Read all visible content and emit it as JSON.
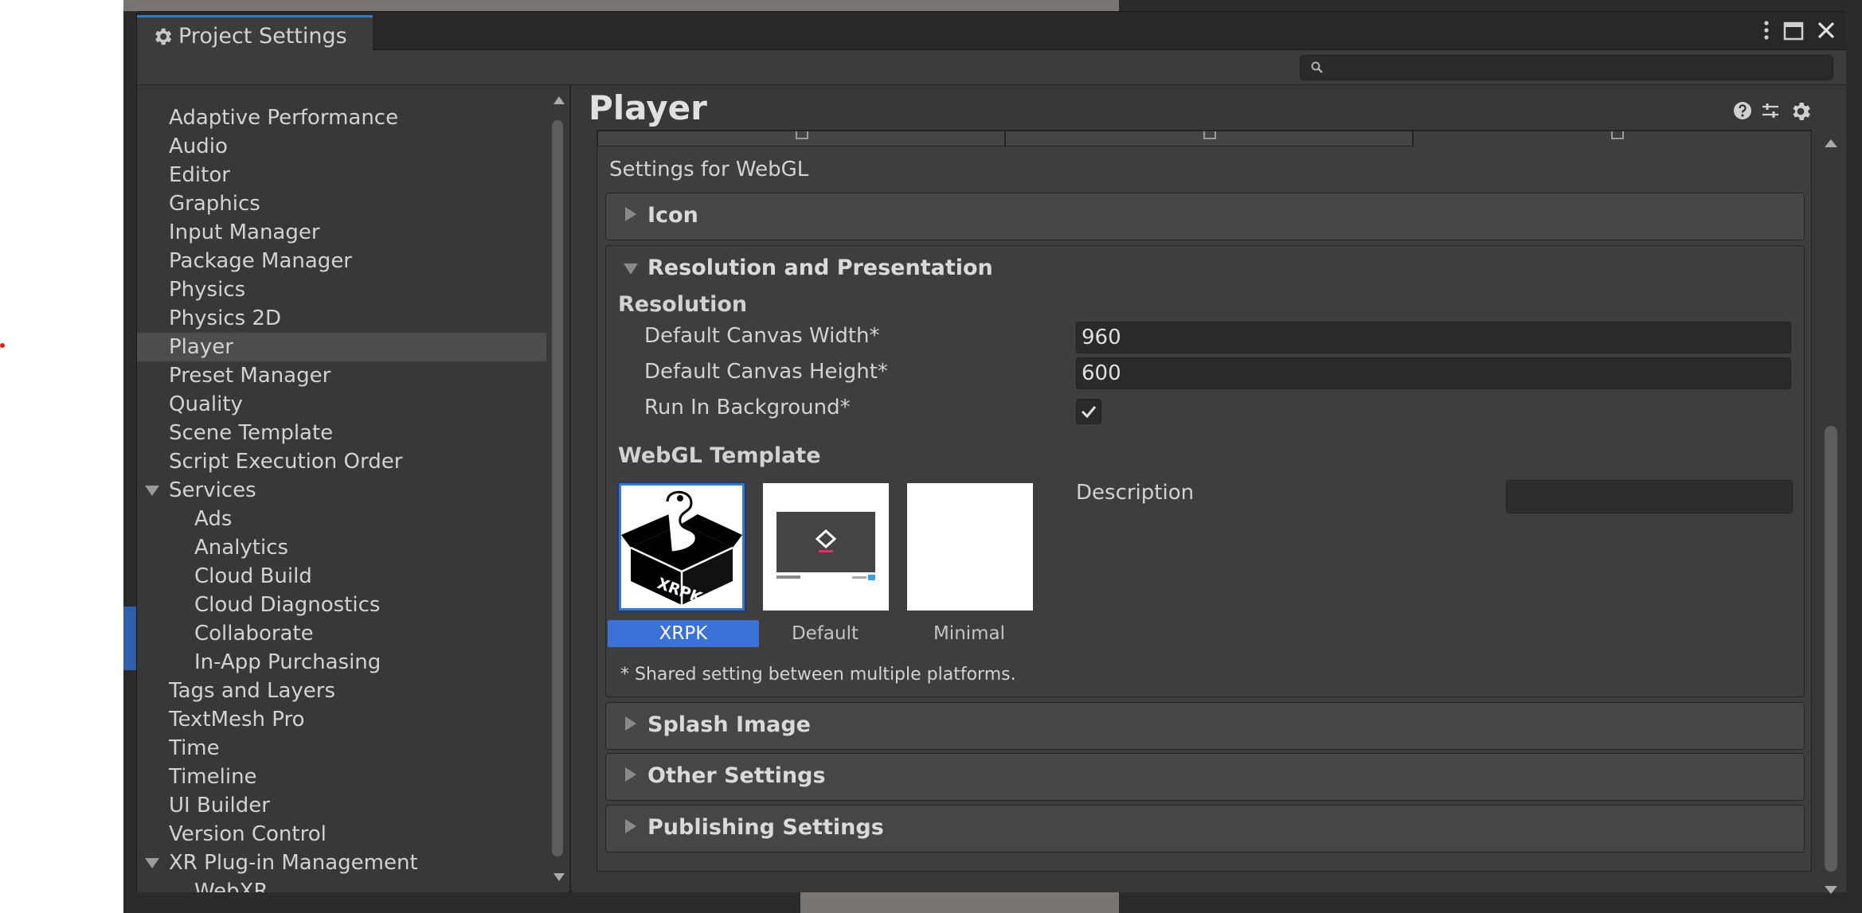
{
  "window": {
    "tab_title": "Project Settings",
    "search_placeholder": ""
  },
  "sidebar": {
    "items": [
      {
        "label": "Adaptive Performance"
      },
      {
        "label": "Audio"
      },
      {
        "label": "Editor"
      },
      {
        "label": "Graphics"
      },
      {
        "label": "Input Manager"
      },
      {
        "label": "Package Manager"
      },
      {
        "label": "Physics"
      },
      {
        "label": "Physics 2D"
      },
      {
        "label": "Player",
        "selected": true
      },
      {
        "label": "Preset Manager"
      },
      {
        "label": "Quality"
      },
      {
        "label": "Scene Template"
      },
      {
        "label": "Script Execution Order"
      },
      {
        "label": "Services",
        "expanded": true
      },
      {
        "label": "Ads"
      },
      {
        "label": "Analytics"
      },
      {
        "label": "Cloud Build"
      },
      {
        "label": "Cloud Diagnostics"
      },
      {
        "label": "Collaborate"
      },
      {
        "label": "In-App Purchasing"
      },
      {
        "label": "Tags and Layers"
      },
      {
        "label": "TextMesh Pro"
      },
      {
        "label": "Time"
      },
      {
        "label": "Timeline"
      },
      {
        "label": "UI Builder"
      },
      {
        "label": "Version Control"
      },
      {
        "label": "XR Plug-in Management",
        "expanded": true
      },
      {
        "label": "WebXR"
      }
    ]
  },
  "main": {
    "title": "Player",
    "settings_for": "Settings for WebGL",
    "sections": {
      "icon": "Icon",
      "resolution_presentation": "Resolution and Presentation",
      "splash_image": "Splash Image",
      "other_settings": "Other Settings",
      "publishing_settings": "Publishing Settings"
    },
    "resolution": {
      "heading": "Resolution",
      "canvas_width_label": "Default Canvas Width*",
      "canvas_width_value": "960",
      "canvas_height_label": "Default Canvas Height*",
      "canvas_height_value": "600",
      "run_in_background_label": "Run In Background*",
      "run_in_background_checked": true
    },
    "webgl_template": {
      "heading": "WebGL Template",
      "templates": [
        {
          "label": "XRPK",
          "selected": true
        },
        {
          "label": "Default"
        },
        {
          "label": "Minimal"
        }
      ],
      "description_label": "Description",
      "description_value": "",
      "xrpk_logo_text": "XRPK"
    },
    "shared_note": "* Shared setting between multiple platforms."
  },
  "colors": {
    "selection_blue": "#3a72d8",
    "tab_accent": "#3a79bb",
    "window_bg": "#383838"
  },
  "icons": [
    "gear-icon",
    "kebab-menu-icon",
    "maximize-icon",
    "close-icon",
    "search-icon",
    "help-icon",
    "preset-icon",
    "settings-icon"
  ]
}
